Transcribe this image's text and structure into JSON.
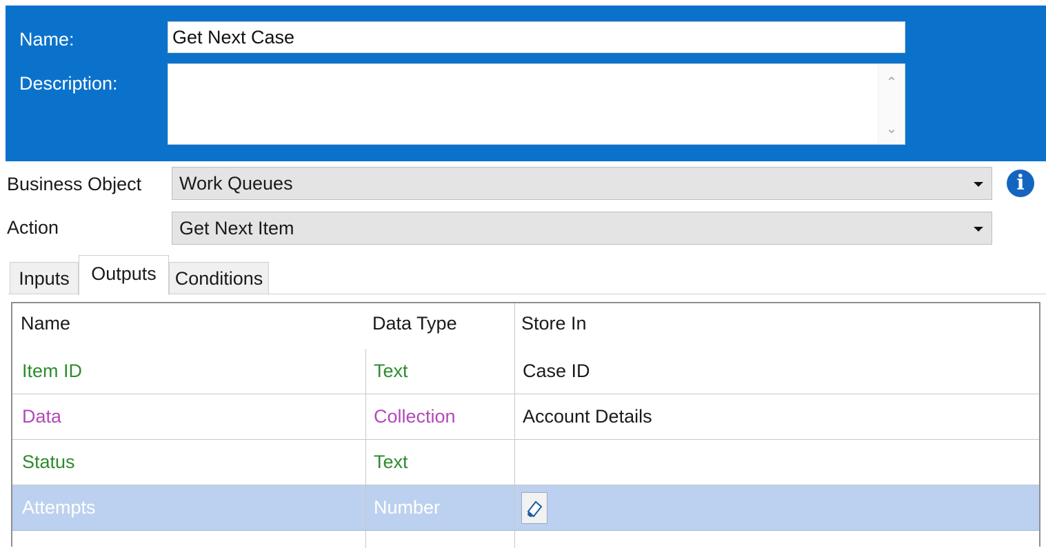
{
  "header": {
    "name_label": "Name:",
    "name_value": "Get Next Case",
    "description_label": "Description:",
    "description_value": ""
  },
  "fields": {
    "business_object_label": "Business Object",
    "business_object_value": "Work Queues",
    "action_label": "Action",
    "action_value": "Get Next Item"
  },
  "tabs": [
    {
      "label": "Inputs"
    },
    {
      "label": "Outputs",
      "active": true
    },
    {
      "label": "Conditions"
    }
  ],
  "grid": {
    "columns": [
      "Name",
      "Data Type",
      "Store In"
    ],
    "rows": [
      {
        "name": "Item ID",
        "type": "Text",
        "store": "Case ID",
        "color": "#2e8b2e"
      },
      {
        "name": "Data",
        "type": "Collection",
        "store": "Account Details",
        "color": "#b04ab8"
      },
      {
        "name": "Status",
        "type": "Text",
        "store": "",
        "color": "#2e8b2e"
      },
      {
        "name": "Attempts",
        "type": "Number",
        "store": "",
        "color": "#ffffff",
        "selected": true
      }
    ]
  },
  "colors": {
    "header_bg": "#0b72cc",
    "selected_row": "#bcd1ef",
    "text_type": "#2e8b2e",
    "collection_type": "#b04ab8"
  },
  "icons": [
    "info-icon",
    "dropdown-arrow-icon",
    "scroll-up-icon",
    "scroll-down-icon",
    "edit-icon"
  ]
}
